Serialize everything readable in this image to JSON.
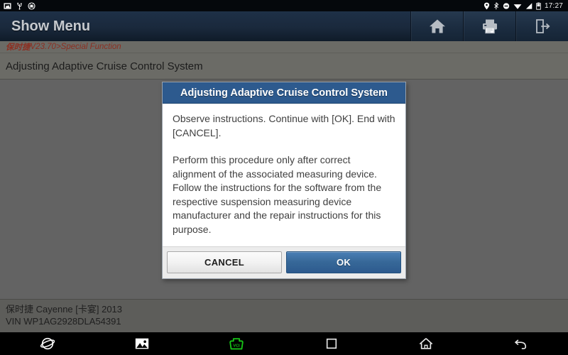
{
  "statusbar": {
    "left_icons": [
      "screenshot-icon",
      "usb-icon",
      "debug-icon"
    ],
    "right_icons": [
      "location-icon",
      "bluetooth-icon",
      "do-not-disturb-icon",
      "wifi-icon",
      "signal-icon",
      "battery-icon"
    ],
    "time": "17:27"
  },
  "header": {
    "title": "Show Menu",
    "buttons": [
      {
        "name": "home-button",
        "icon": "home-icon"
      },
      {
        "name": "print-button",
        "icon": "printer-icon"
      },
      {
        "name": "exit-button",
        "icon": "exit-icon"
      }
    ]
  },
  "breadcrumb": {
    "brand": "保时捷",
    "version": " V23.70 ",
    "separator": "> ",
    "section": "Special Function",
    "color": "#8c2f22"
  },
  "page": {
    "title": "Adjusting Adaptive Cruise Control System"
  },
  "dialog": {
    "title": "Adjusting Adaptive Cruise Control System",
    "paragraphs": [
      "Observe instructions. Continue with [OK]. End with [CANCEL].",
      "Perform this procedure only after correct alignment of the associated measuring device. Follow the instructions for the software from the respective suspension measuring device manufacturer and the repair instructions for this purpose."
    ],
    "cancel_label": "CANCEL",
    "ok_label": "OK",
    "title_bg": "#2d5a8e",
    "ok_bg": "#376898"
  },
  "vehicle": {
    "line1": "保时捷 Cayenne [卡宴] 2013",
    "line2": "VIN WP1AG2928DLA54391"
  },
  "navbar": {
    "items": [
      {
        "name": "browser-icon"
      },
      {
        "name": "gallery-icon"
      },
      {
        "name": "vci-icon",
        "color": "#17c217"
      },
      {
        "name": "recents-icon"
      },
      {
        "name": "android-home-icon"
      },
      {
        "name": "back-icon"
      }
    ]
  }
}
